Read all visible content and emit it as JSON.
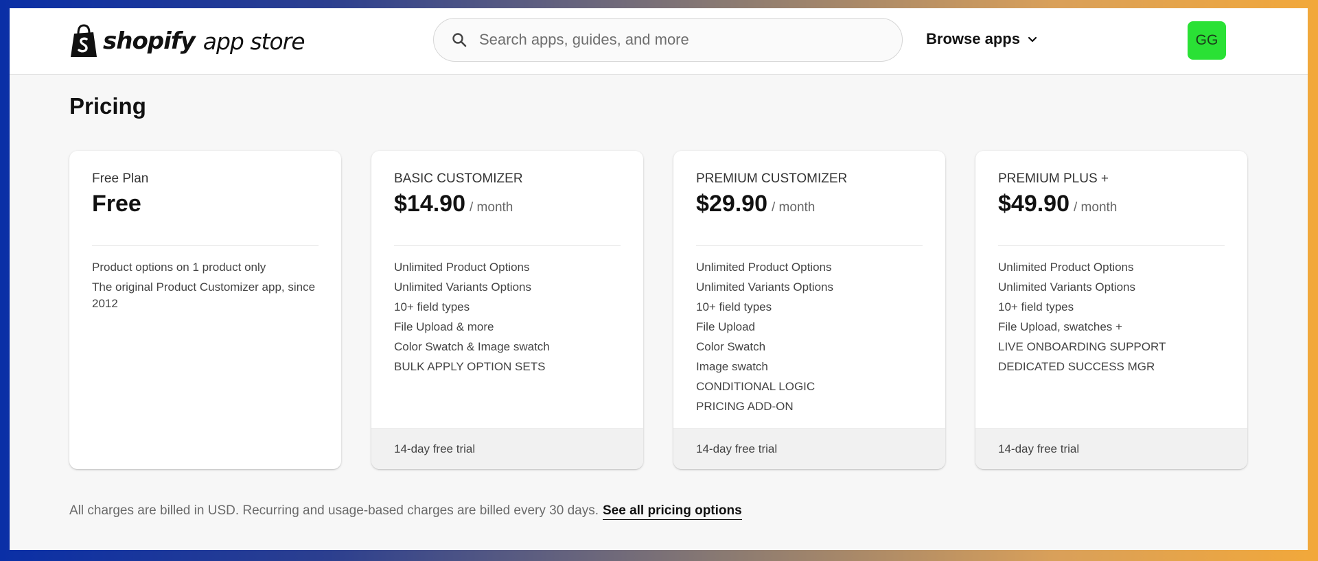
{
  "header": {
    "logo_brand": "shopify",
    "logo_sub": "app store",
    "search_placeholder": "Search apps, guides, and more",
    "browse_label": "Browse apps",
    "avatar_initials": "GG",
    "avatar_color": "#2ae135"
  },
  "pricing": {
    "title": "Pricing",
    "plans": [
      {
        "name": "Free Plan",
        "amount": "Free",
        "period": "",
        "features": [
          "Product options on 1 product only",
          "The original Product Customizer app, since 2012"
        ],
        "trial": ""
      },
      {
        "name": "BASIC CUSTOMIZER",
        "amount": "$14.90",
        "period": "/ month",
        "features": [
          "Unlimited Product Options",
          "Unlimited Variants Options",
          "10+ field types",
          "File Upload & more",
          "Color Swatch & Image swatch",
          "BULK APPLY OPTION SETS"
        ],
        "trial": "14-day free trial"
      },
      {
        "name": "PREMIUM CUSTOMIZER",
        "amount": "$29.90",
        "period": "/ month",
        "features": [
          "Unlimited Product Options",
          "Unlimited Variants Options",
          "10+ field types",
          "File Upload",
          "Color Swatch",
          "Image swatch",
          "CONDITIONAL LOGIC",
          "PRICING ADD-ON"
        ],
        "trial": "14-day free trial"
      },
      {
        "name": "PREMIUM PLUS +",
        "amount": "$49.90",
        "period": "/ month",
        "features": [
          "Unlimited Product Options",
          "Unlimited Variants Options",
          "10+ field types",
          "File Upload, swatches +",
          "LIVE ONBOARDING SUPPORT",
          "DEDICATED SUCCESS MGR"
        ],
        "trial": "14-day free trial"
      }
    ],
    "footnote": "All charges are billed in USD. Recurring and usage-based charges are billed every 30 days.",
    "footnote_link": "See all pricing options"
  }
}
